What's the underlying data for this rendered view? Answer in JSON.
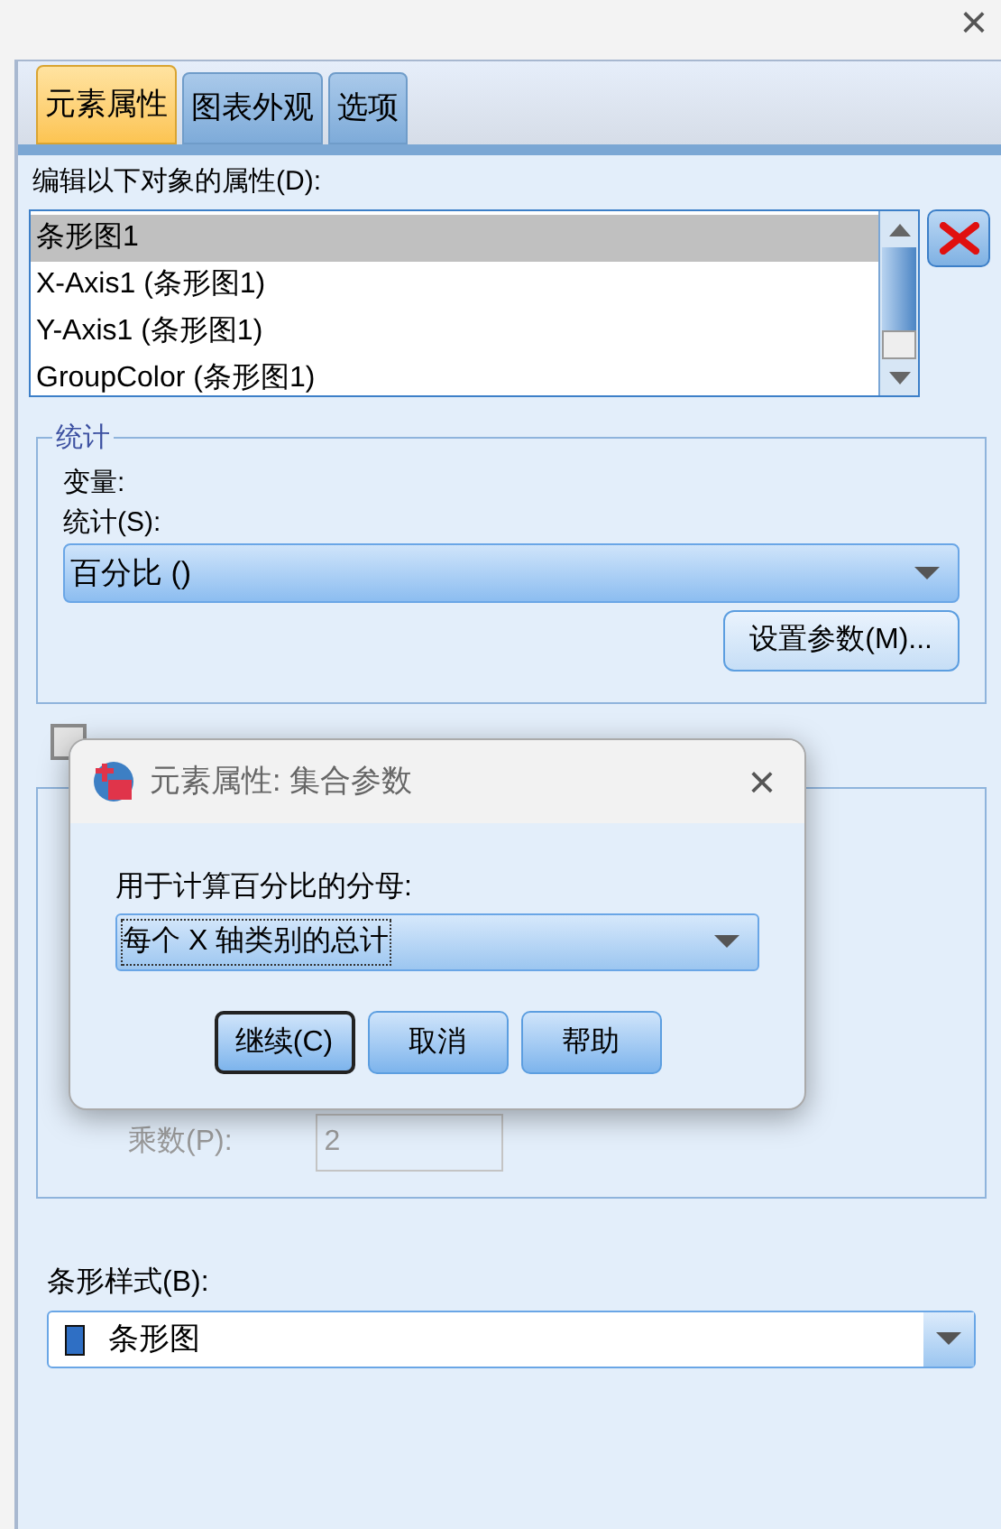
{
  "window": {
    "close": "×"
  },
  "tabs": [
    {
      "label": "元素属性",
      "selected": true
    },
    {
      "label": "图表外观",
      "selected": false
    },
    {
      "label": "选项",
      "selected": false
    }
  ],
  "objects": {
    "label": "编辑以下对象的属性(D):",
    "items": [
      {
        "text": "条形图1",
        "selected": true
      },
      {
        "text": "X-Axis1 (条形图1)",
        "selected": false
      },
      {
        "text": "Y-Axis1 (条形图1)",
        "selected": false
      },
      {
        "text": "GroupColor (条形图1)",
        "selected": false
      }
    ]
  },
  "statistics": {
    "legend": "统计",
    "variable_label": "变量:",
    "statistic_label": "统计(S):",
    "statistic_value": "百分比 ()",
    "parameters_button": "设置参数(M)..."
  },
  "error_bars": {
    "checked": false,
    "disabled": true
  },
  "multiplier": {
    "label": "乘数(P):",
    "value": "2",
    "disabled": true
  },
  "bar_style": {
    "label": "条形样式(B):",
    "value": "条形图"
  },
  "dialog": {
    "title": "元素属性: 集合参数",
    "close": "×",
    "denominator_label": "用于计算百分比的分母:",
    "denominator_value": "每个 X 轴类别的总计",
    "buttons": [
      {
        "label": "继续(C)",
        "default": true
      },
      {
        "label": "取消",
        "default": false
      },
      {
        "label": "帮助",
        "default": false
      }
    ]
  }
}
